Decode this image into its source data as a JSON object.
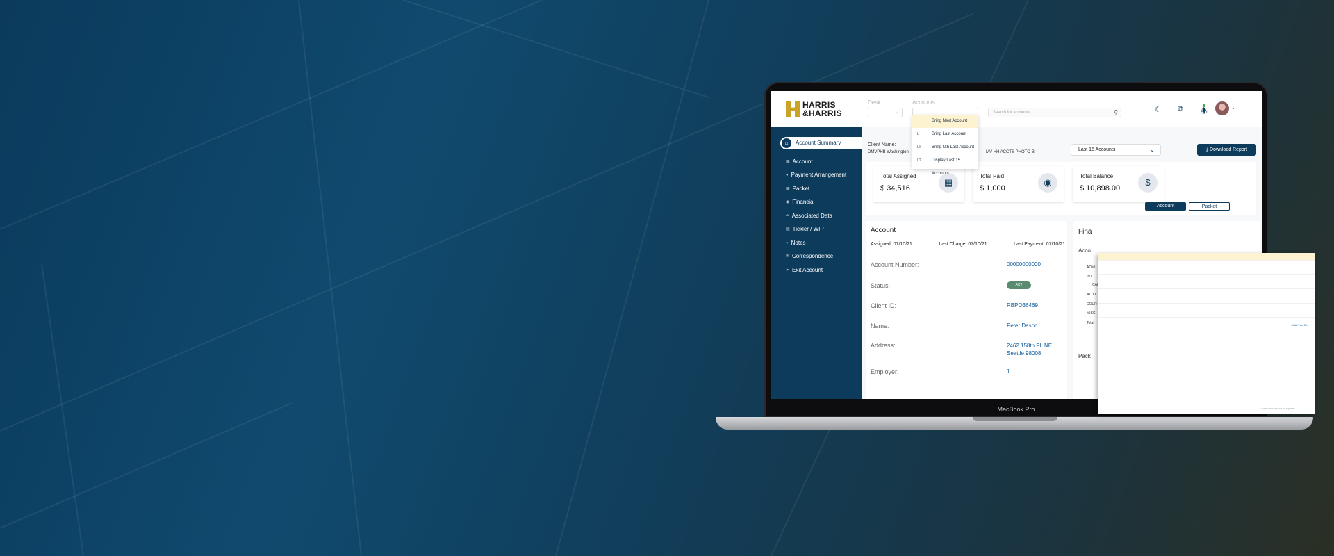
{
  "header": {
    "logo_line1": "HARRIS",
    "logo_line2": "&HARRIS",
    "desk_label": "Desk",
    "accounts_label": "Accounts",
    "search_placeholder": "Search for accounts"
  },
  "accounts_dropdown": [
    {
      "key": "",
      "label": "Bring Next Account"
    },
    {
      "key": "L",
      "label": "Bring Last Account"
    },
    {
      "key": "L#",
      "label": "Bring Nth Last Account"
    },
    {
      "key": "L?",
      "label": "Display Last 15 Accounts"
    }
  ],
  "sidebar": {
    "active": "Account Summary",
    "items": [
      "Account",
      "Payment Arrangement",
      "Packet",
      "Financial",
      "Associated Data",
      "Tickler / WIP",
      "Notes",
      "Correspondence",
      "Exit Account"
    ]
  },
  "client": {
    "label": "Client Name:",
    "value_left": "DMVPHB Washington",
    "value_right": "MV HH ACCTS PHOTO-B"
  },
  "controls": {
    "accounts_select": "Last 15 Accounts",
    "download_button": "Download Report",
    "account_tab": "Account",
    "packet_tab": "Packet"
  },
  "cards": [
    {
      "title": "Total  Assigned",
      "value": "$ 34,516",
      "icon": "chart-icon"
    },
    {
      "title": "Total Paid",
      "value": "$ 1,000",
      "icon": "payment-icon"
    },
    {
      "title": "Total Balance",
      "value": "$ 10,898.00",
      "icon": "dollar-icon"
    }
  ],
  "account_panel": {
    "title": "Account",
    "assigned": "Assigned: 07/10/21",
    "last_charge": "Last Charge: 07/10/21",
    "last_payment": "Last Payment: 07/10/21",
    "rows": [
      {
        "label": "Account Number:",
        "value": "00000000000"
      },
      {
        "label": "Status:",
        "value": "ACT"
      },
      {
        "label": "Client ID:",
        "value": "RBPO36469"
      },
      {
        "label": "Name:",
        "value": "Peter Dason"
      },
      {
        "label": "Address:",
        "value": "2462 158th PL NE, Seattle 98008"
      },
      {
        "label": "Employer:",
        "value": "1"
      }
    ]
  },
  "financial_panel": {
    "title": "Fina",
    "sub_title": "Acco",
    "lines": [
      "ADMI",
      "INT",
      "CAN",
      "ATTOI",
      "COUR",
      "MISC",
      "Total"
    ],
    "packet_title": "Pack"
  },
  "macbook_label": "MacBook Pro",
  "overlay": {
    "add_link": "+ Add Fee Co",
    "footer": "© 2021 Harris & Harris. All Rights Re"
  }
}
